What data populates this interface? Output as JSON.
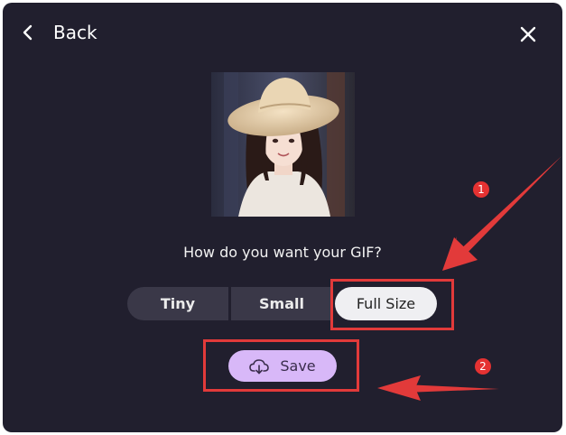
{
  "header": {
    "back_label": "Back"
  },
  "main": {
    "question": "How do you want your GIF?",
    "size_options": [
      {
        "label": "Tiny",
        "selected": false
      },
      {
        "label": "Small",
        "selected": false
      },
      {
        "label": "Full Size",
        "selected": true
      }
    ],
    "save_label": "Save"
  },
  "annotations": {
    "badge_1": "1",
    "badge_2": "2",
    "color": "#e23a3a"
  },
  "icons": {
    "back": "chevron-left-icon",
    "close": "close-icon",
    "save": "cloud-download-icon"
  },
  "colors": {
    "background": "#211f2e",
    "selected_option_bg": "#efeff2",
    "option_bg": "#3a3848",
    "save_button_bg": "#d8b8f8",
    "annotation_red": "#e23a3a"
  }
}
